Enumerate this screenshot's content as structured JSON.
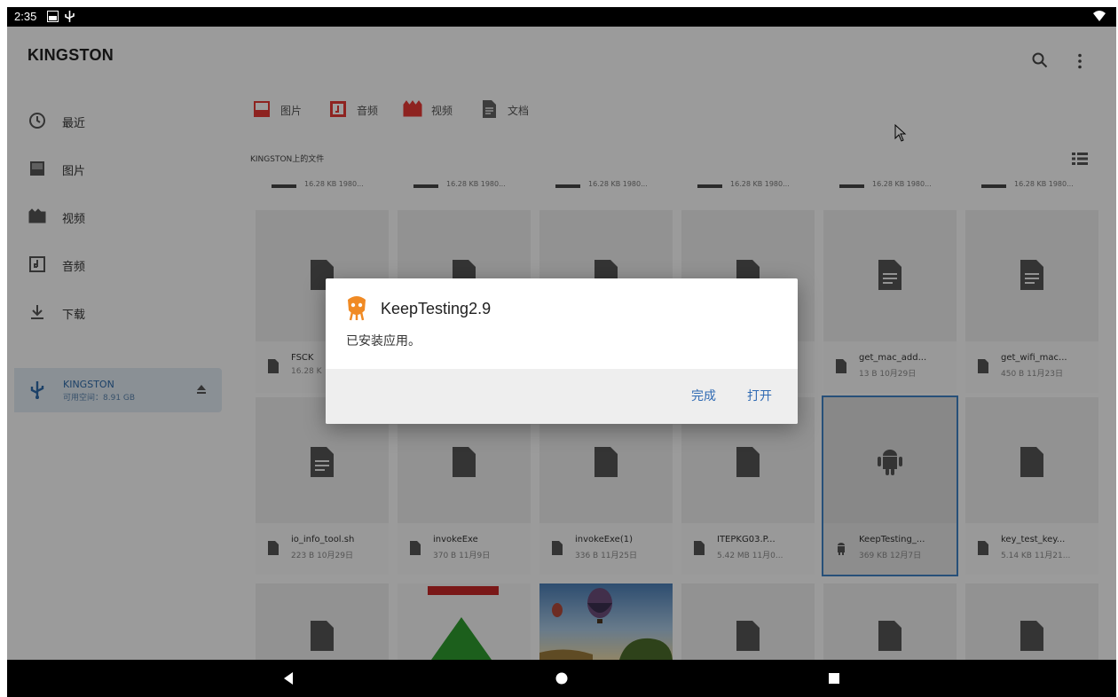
{
  "status_bar": {
    "time": "2:35"
  },
  "app_bar": {
    "title": "KINGSTON",
    "icons": [
      "search-icon",
      "more-vert-icon"
    ]
  },
  "sidebar": {
    "items": [
      {
        "label": "最近",
        "icon": "clock-icon"
      },
      {
        "label": "图片",
        "icon": "image-icon"
      },
      {
        "label": "视频",
        "icon": "video-icon"
      },
      {
        "label": "音频",
        "icon": "audio-icon"
      },
      {
        "label": "下载",
        "icon": "download-icon"
      }
    ],
    "device": {
      "name": "KINGSTON",
      "space": "可用空间：8.91 GB",
      "icon": "usb-icon"
    }
  },
  "main": {
    "filter_chips": [
      {
        "label": "图片",
        "color": "#e53935"
      },
      {
        "label": "音频",
        "color": "#e53935"
      },
      {
        "label": "视频",
        "color": "#e53935"
      },
      {
        "label": "文档",
        "color": "#616161"
      }
    ],
    "section_title": "KINGSTON上的文件",
    "partial_row_meta": [
      "16.28 KB 1980...",
      "16.28 KB 1980...",
      "16.28 KB 1980...",
      "16.28 KB 1980...",
      "16.28 KB 1980...",
      "16.28 KB 1980..."
    ],
    "row1": [
      {
        "name": "FSCK",
        "meta": "16.28 K"
      },
      {
        "name": "",
        "meta": ""
      },
      {
        "name": "",
        "meta": ""
      },
      {
        "name": "",
        "meta": ""
      },
      {
        "name": "get_mac_add...",
        "meta": "13 B 10月29日"
      },
      {
        "name": "get_wifi_mac...",
        "meta": "450 B 11月23日"
      }
    ],
    "row2": [
      {
        "name": "io_info_tool.sh",
        "meta": "223 B 10月29日"
      },
      {
        "name": "invokeExe",
        "meta": "370 B 11月9日"
      },
      {
        "name": "invokeExe(1)",
        "meta": "336 B 11月25日"
      },
      {
        "name": "ITEPKG03.P...",
        "meta": "5.42 MB 11月0..."
      },
      {
        "name": "KeepTesting_...",
        "meta": "369 KB 12月7日"
      },
      {
        "name": "key_test_key...",
        "meta": "5.14 KB 11月21..."
      }
    ]
  },
  "dialog": {
    "title": "KeepTesting2.9",
    "message": "已安装应用。",
    "done_label": "完成",
    "open_label": "打开",
    "accent": "#2f6ab3"
  },
  "nav_bar": {
    "icons": [
      "back-icon",
      "home-icon",
      "recents-icon"
    ]
  }
}
